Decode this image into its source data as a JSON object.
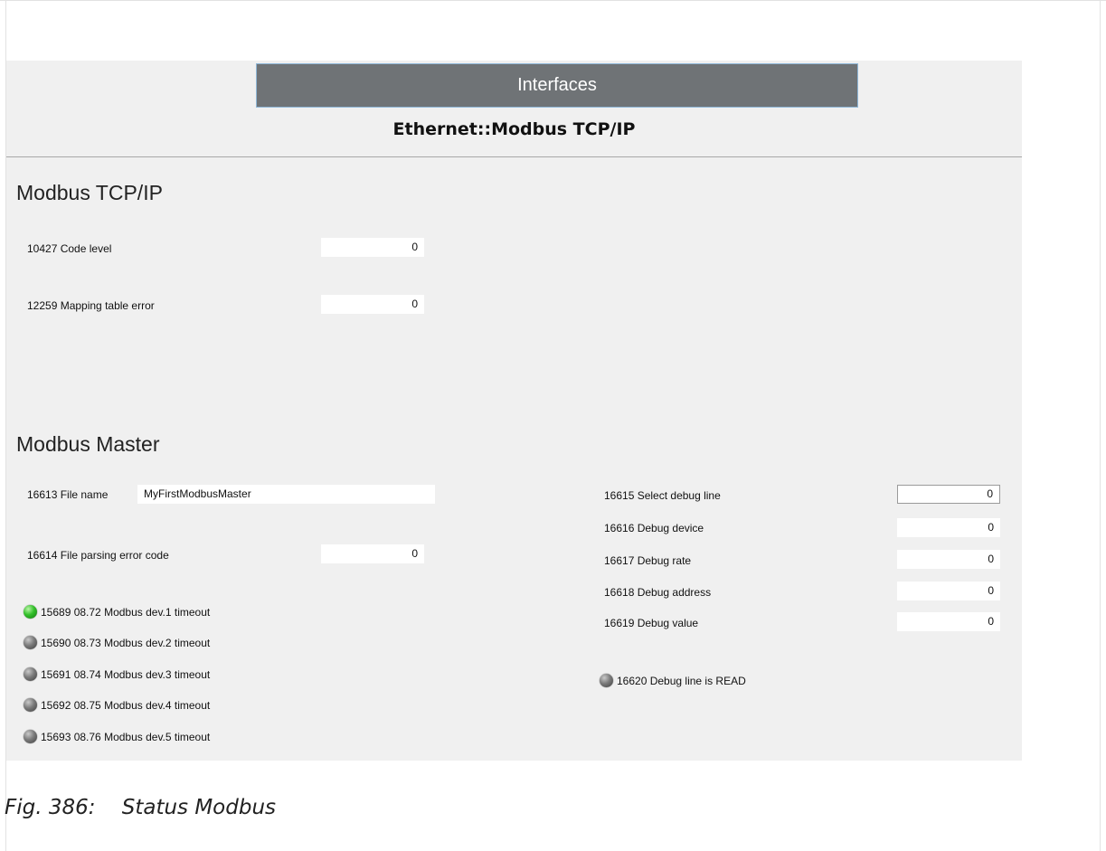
{
  "header": {
    "title": "Interfaces",
    "subtitle": "Ethernet::Modbus TCP/IP"
  },
  "modbus_tcp": {
    "section_title": "Modbus TCP/IP",
    "code_level": {
      "label": "10427 Code level",
      "value": "0"
    },
    "mapping_table_error": {
      "label": "12259 Mapping table error",
      "value": "0"
    }
  },
  "modbus_master": {
    "section_title": "Modbus Master",
    "file_name": {
      "label": "16613 File name",
      "value": "MyFirstModbusMaster"
    },
    "file_parsing_error": {
      "label": "16614 File parsing error code",
      "value": "0"
    },
    "timeouts": [
      {
        "label": "15689 08.72 Modbus dev.1 timeout",
        "state": "on",
        "color": "#33c02a"
      },
      {
        "label": "15690 08.73 Modbus dev.2 timeout",
        "state": "off",
        "color": "#6e6e6e"
      },
      {
        "label": "15691 08.74 Modbus dev.3 timeout",
        "state": "off",
        "color": "#6e6e6e"
      },
      {
        "label": "15692 08.75 Modbus dev.4 timeout",
        "state": "off",
        "color": "#6e6e6e"
      },
      {
        "label": "15693 08.76 Modbus dev.5 timeout",
        "state": "off",
        "color": "#6e6e6e"
      }
    ],
    "debug": {
      "select_line": {
        "label": "16615 Select debug line",
        "value": "0"
      },
      "device": {
        "label": "16616 Debug device",
        "value": "0"
      },
      "rate": {
        "label": "16617 Debug rate",
        "value": "0"
      },
      "address": {
        "label": "16618 Debug address",
        "value": "0"
      },
      "value": {
        "label": "16619 Debug value",
        "value": "0"
      },
      "line_is_read": {
        "label": "16620 Debug line is READ",
        "state": "off",
        "color": "#6e6e6e"
      }
    }
  },
  "caption": "Fig. 386:    Status Modbus"
}
